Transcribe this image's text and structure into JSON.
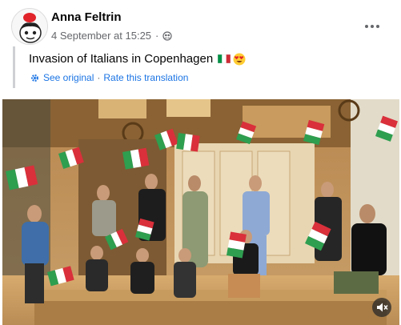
{
  "post": {
    "author": "Anna Feltrin",
    "date": "4 September at 15:25",
    "separator": "·",
    "privacy_icon": "friends-globe-icon",
    "caption": "Invasion of Italians in Copenhagen",
    "caption_emoji": [
      "italian-flag-icon",
      "heart-eyes-emoji"
    ],
    "translation": {
      "see_original": "See original",
      "dot": "·",
      "rate": "Rate this translation"
    }
  },
  "media": {
    "type": "video",
    "description_icon": "mute-icon"
  },
  "colors": {
    "link": "#1b74e4",
    "secondary_text": "#65676b",
    "quote_bar": "#ced0d4"
  }
}
